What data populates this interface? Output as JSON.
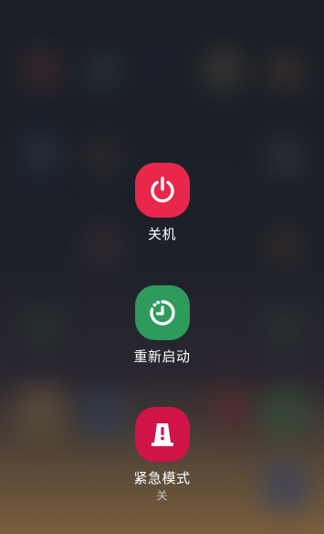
{
  "power_menu": {
    "power_off": {
      "label": "关机",
      "icon": "power-icon",
      "color": "#e8274b"
    },
    "restart": {
      "label": "重新启动",
      "icon": "restart-icon",
      "color": "#2e9a5c"
    },
    "emergency_mode": {
      "label": "紧急模式",
      "status": "关",
      "icon": "emergency-beacon-icon",
      "color": "#d01448"
    }
  }
}
